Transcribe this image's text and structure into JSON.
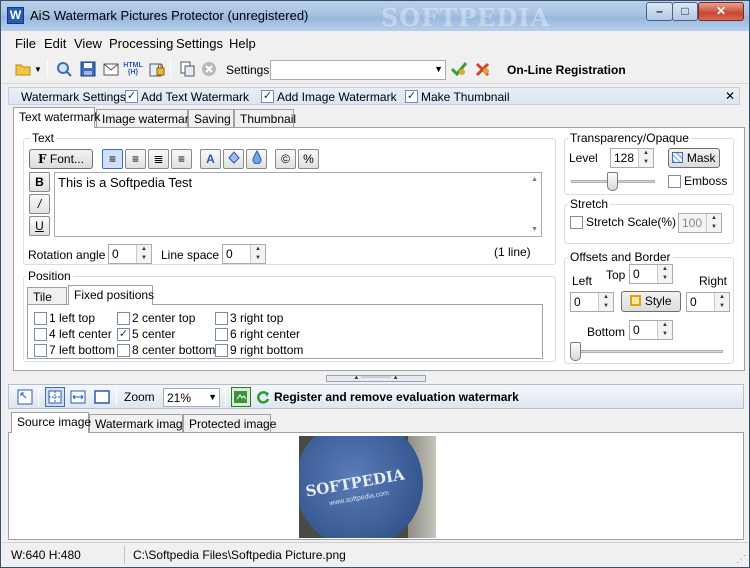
{
  "window": {
    "title": "AiS Watermark Pictures Protector (unregistered)",
    "app_icon_letter": "W",
    "watermark_overlay": "SOFTPEDIA",
    "controls": {
      "minimize": "–",
      "maximize": "□",
      "close": "✕"
    }
  },
  "menu": [
    "File",
    "Edit",
    "View",
    "Processing",
    "Settings",
    "Help"
  ],
  "toolbar": {
    "settings_label": "Settings",
    "settings_value": "",
    "registration_link": "On-Line Registration",
    "icons": [
      "open-folder-icon",
      "preview-icon",
      "save-icon",
      "email-icon",
      "html-export-icon",
      "protect-icon",
      "copy-icon",
      "stop-icon",
      "apply-settings-icon",
      "delete-settings-icon"
    ]
  },
  "watermark_settings": {
    "label": "Watermark Settings:",
    "items": [
      {
        "label": "Add Text Watermark",
        "checked": true
      },
      {
        "label": "Add Image Watermark",
        "checked": true
      },
      {
        "label": "Make Thumbnail",
        "checked": true
      }
    ],
    "close": "✕"
  },
  "settings_tabs": [
    {
      "label": "Text watermark",
      "active": true
    },
    {
      "label": "Image watermark",
      "active": false
    },
    {
      "label": "Saving",
      "active": false
    },
    {
      "label": "Thumbnail",
      "active": false
    }
  ],
  "text_group": {
    "title": "Text",
    "font_button": "Font...",
    "font_button_icon": "F",
    "text_value": "This is a Softpedia Test",
    "bold": "B",
    "italic": "/",
    "underline": "U",
    "copyright": "©",
    "percent": "%",
    "rotation_label": "Rotation angle",
    "rotation_value": "0",
    "line_space_label": "Line space",
    "line_space_value": "0",
    "line_count": "(1 line)"
  },
  "position_group": {
    "title": "Position",
    "tabs": [
      {
        "label": "Tile",
        "active": false
      },
      {
        "label": "Fixed positions",
        "active": true
      }
    ],
    "positions": [
      {
        "label": "1 left top",
        "checked": false
      },
      {
        "label": "2 center top",
        "checked": false
      },
      {
        "label": "3 right top",
        "checked": false
      },
      {
        "label": "4 left center",
        "checked": false
      },
      {
        "label": "5 center",
        "checked": true
      },
      {
        "label": "6 right center",
        "checked": false
      },
      {
        "label": "7 left bottom",
        "checked": false
      },
      {
        "label": "8 center bottom",
        "checked": false
      },
      {
        "label": "9 right bottom",
        "checked": false
      }
    ]
  },
  "transparency_group": {
    "title": "Transparency/Opaque",
    "level_label": "Level",
    "level_value": "128",
    "level_max": 255,
    "mask_button": "Mask",
    "emboss_label": "Emboss",
    "emboss_checked": false
  },
  "stretch_group": {
    "title": "Stretch",
    "scale_label": "Stretch Scale(%)",
    "scale_checked": false,
    "scale_value": "100"
  },
  "offsets_group": {
    "title": "Offsets and Border",
    "left_label": "Left",
    "left_value": "0",
    "top_label": "Top",
    "top_value": "0",
    "right_label": "Right",
    "right_value": "0",
    "bottom_label": "Bottom",
    "bottom_value": "0",
    "style_button": "Style",
    "border_level": 0
  },
  "splitter_glyph": "▲ ⋯⋯⋯⋯⋯ ▲",
  "view_toolbar": {
    "zoom_label": "Zoom",
    "zoom_value": "21%",
    "register_text": "Register and remove evaluation watermark"
  },
  "image_tabs": [
    {
      "label": "Source image",
      "active": true
    },
    {
      "label": "Watermark image",
      "active": false
    },
    {
      "label": "Protected image",
      "active": false
    }
  ],
  "preview": {
    "brand_text": "SOFTPEDIA",
    "url_text": "www.softpedia.com"
  },
  "status": {
    "dimensions": "W:640 H:480",
    "path": "C:\\Softpedia Files\\Softpedia Picture.png"
  },
  "colors": {
    "accent": "#2a5ab8",
    "titlebar": "#a7c3e3",
    "close": "#c9462f"
  }
}
